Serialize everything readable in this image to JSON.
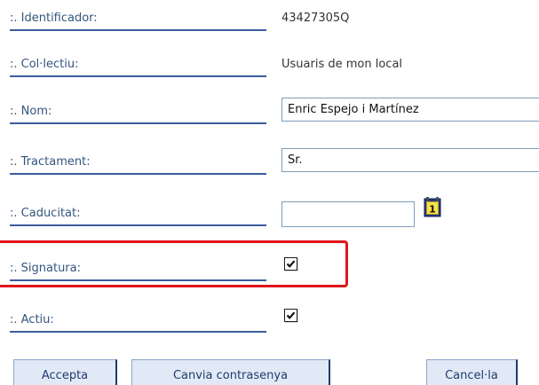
{
  "form": {
    "identificador": {
      "label": ":. Identificador:",
      "value": "43427305Q"
    },
    "collectiu": {
      "label": ":. Col·lectiu:",
      "value": "Usuaris de mon local"
    },
    "nom": {
      "label": ":. Nom:",
      "value": "Enric Espejo i Martínez"
    },
    "tractament": {
      "label": ":. Tractament:",
      "value": "Sr."
    },
    "caducitat": {
      "label": ":. Caducitat:",
      "value": "",
      "icon": "calendar-icon"
    },
    "signatura": {
      "label": ":. Signatura:",
      "checked": true
    },
    "actiu": {
      "label": ":. Actiu:",
      "checked": true
    }
  },
  "buttons": {
    "accepta": "Accepta",
    "canvia_contrasenya": "Canvia contrasenya",
    "cancella": "Cancel·la"
  },
  "colors": {
    "label_text": "#33557d",
    "underline": "#3a5c9c",
    "highlight": "#e0151c",
    "button_bg": "#e2e9f6"
  }
}
